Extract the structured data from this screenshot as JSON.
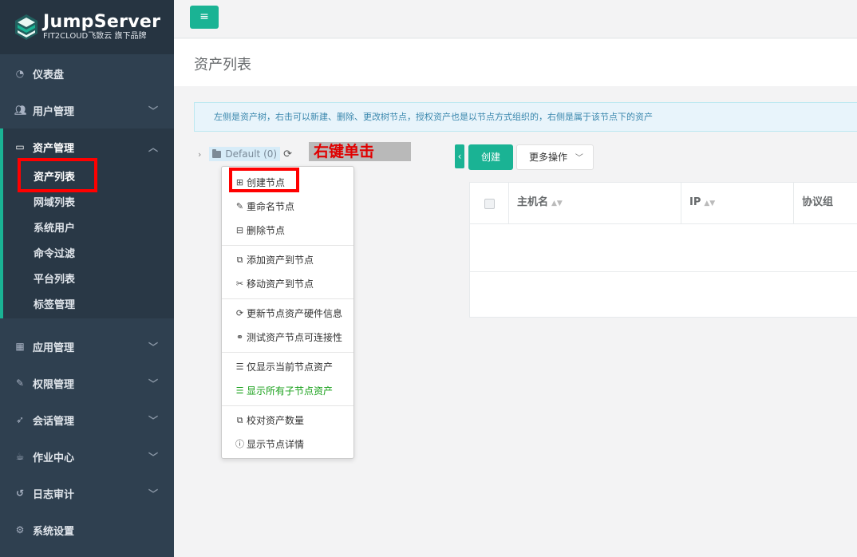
{
  "brand": {
    "title": "JumpServer",
    "subtitle": "FIT2CLOUD飞致云 旗下品牌"
  },
  "sidebar": {
    "items": [
      {
        "label": "仪表盘",
        "icon": "dashboard-icon"
      },
      {
        "label": "用户管理",
        "icon": "users-icon"
      },
      {
        "label": "资产管理",
        "icon": "inbox-icon"
      },
      {
        "label": "应用管理",
        "icon": "grid-icon"
      },
      {
        "label": "权限管理",
        "icon": "edit-icon"
      },
      {
        "label": "会话管理",
        "icon": "rocket-icon"
      },
      {
        "label": "作业中心",
        "icon": "coffee-icon"
      },
      {
        "label": "日志审计",
        "icon": "history-icon"
      },
      {
        "label": "系统设置",
        "icon": "gears-icon"
      }
    ],
    "asset_sub_items": [
      "资产列表",
      "网域列表",
      "系统用户",
      "命令过滤",
      "平台列表",
      "标签管理"
    ]
  },
  "page": {
    "title": "资产列表",
    "info": "左侧是资产树，右击可以新建、删除、更改树节点，授权资产也是以节点方式组织的，右侧是属于该节点下的资产"
  },
  "tree": {
    "node_label": "Default (0)"
  },
  "annotation": "右键单击",
  "context_menu": {
    "items": [
      "创建节点",
      "重命名节点",
      "删除节点",
      "添加资产到节点",
      "移动资产到节点",
      "更新节点资产硬件信息",
      "测试资产节点可连接性",
      "仅显示当前节点资产",
      "显示所有子节点资产",
      "校对资产数量",
      "显示节点详情"
    ]
  },
  "toolbar": {
    "create_label": "创建",
    "more_label": "更多操作"
  },
  "table": {
    "columns": [
      "主机名",
      "IP",
      "协议组"
    ]
  },
  "colors": {
    "accent": "#1ab394",
    "sidebar_bg": "#2f4050",
    "highlight_red": "#ff0000"
  }
}
